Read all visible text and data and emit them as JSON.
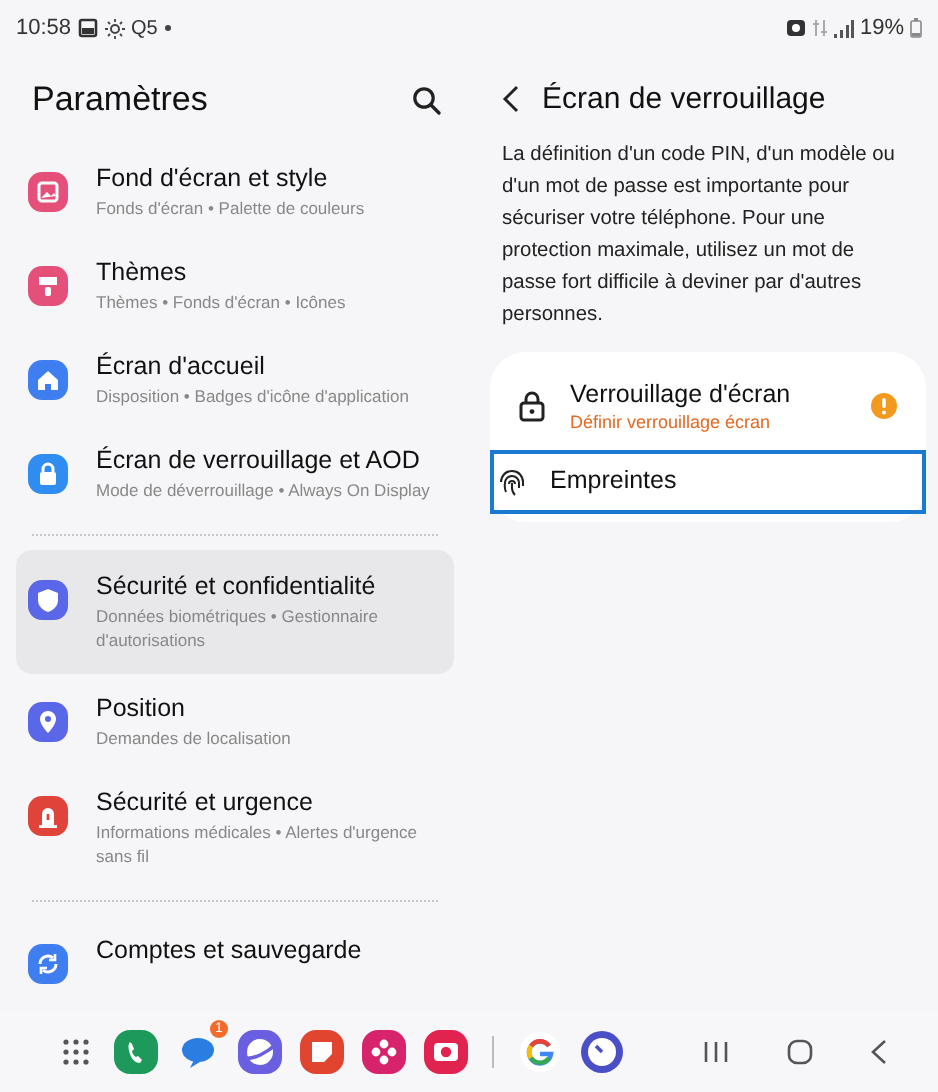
{
  "status_bar": {
    "time": "10:58",
    "status_text": "Q5",
    "battery": "19%"
  },
  "settings": {
    "title": "Paramètres",
    "groups": [
      [
        {
          "kind": "wallpaper",
          "color": "#e5507a",
          "title": "Fond d'écran et style",
          "subtitle": "Fonds d'écran  •  Palette de couleurs",
          "selected": false
        },
        {
          "kind": "themes",
          "color": "#e5507a",
          "title": "Thèmes",
          "subtitle": "Thèmes  •  Fonds d'écran  •  Icônes",
          "selected": false
        },
        {
          "kind": "home",
          "color": "#3e7ef0",
          "title": "Écran d'accueil",
          "subtitle": "Disposition  •  Badges d'icône d'application",
          "selected": false
        },
        {
          "kind": "lock",
          "color": "#2f8cf0",
          "title": "Écran de verrouillage et AOD",
          "subtitle": "Mode de déverrouillage  •  Always On Display",
          "selected": false
        }
      ],
      [
        {
          "kind": "shield",
          "color": "#5a67e8",
          "title": "Sécurité et confidentialité",
          "subtitle": "Données biométriques  •  Gestionnaire d'autorisations",
          "selected": true
        },
        {
          "kind": "pin",
          "color": "#5a67e8",
          "title": "Position",
          "subtitle": "Demandes de localisation",
          "selected": false
        },
        {
          "kind": "alert",
          "color": "#e0433a",
          "title": "Sécurité et urgence",
          "subtitle": "Informations médicales  •  Alertes d'urgence sans fil",
          "selected": false
        }
      ],
      [
        {
          "kind": "sync",
          "color": "#3e7ef0",
          "title": "Comptes et sauvegarde",
          "selected": false
        }
      ]
    ]
  },
  "lock_screen": {
    "title": "Écran de verrouillage",
    "description": "La définition d'un code PIN, d'un modèle ou d'un mot de passe est importante pour sécuriser votre téléphone. Pour une protection maximale, utilisez un mot de passe fort difficile à deviner par d'autres personnes.",
    "options": [
      {
        "kind": "lock",
        "title": "Verrouillage d'écran",
        "subtitle": "Définir verrouillage écran",
        "warning": true,
        "focused": false
      },
      {
        "kind": "fingerprint",
        "title": "Empreintes",
        "warning": false,
        "focused": true
      }
    ]
  },
  "taskbar": {
    "apps": [
      {
        "kind": "phone",
        "color": "#1d9a5b"
      },
      {
        "kind": "messages",
        "color": "#2a7de1",
        "badge": "1"
      },
      {
        "kind": "internet",
        "color": "#6a5fe0"
      },
      {
        "kind": "notes",
        "color": "#e2452f"
      },
      {
        "kind": "flower",
        "color": "#d6236b"
      },
      {
        "kind": "camera",
        "color": "#e0234f"
      },
      {
        "kind": "google",
        "color": "#ffffff"
      },
      {
        "kind": "clock",
        "color": "#4a4fc8"
      }
    ]
  }
}
